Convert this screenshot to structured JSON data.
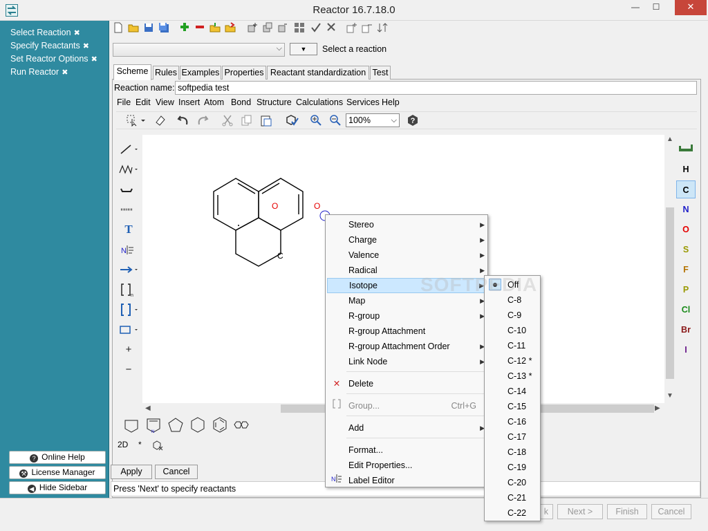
{
  "window": {
    "title": "Reactor 16.7.18.0",
    "min_glyph": "—",
    "max_glyph": "☐",
    "close_glyph": "✕"
  },
  "sidebar": {
    "steps": [
      {
        "label": "Select Reaction"
      },
      {
        "label": "Specify Reactants"
      },
      {
        "label": "Set Reactor Options"
      },
      {
        "label": "Run Reactor"
      }
    ],
    "step_marker": "✖",
    "online_help": "Online Help",
    "license_manager": "License Manager",
    "hide_sidebar": "Hide Sidebar"
  },
  "reaction_select": {
    "dropdown_glyph": "▼",
    "label": "Select a reaction"
  },
  "tabs": [
    {
      "label": "Scheme"
    },
    {
      "label": "Rules"
    },
    {
      "label": "Examples"
    },
    {
      "label": "Properties"
    },
    {
      "label": "Reactant standardization"
    },
    {
      "label": "Test"
    }
  ],
  "reaction_name": {
    "label": "Reaction name:",
    "value": "softpedia test"
  },
  "menubar": [
    {
      "label": "File"
    },
    {
      "label": "Edit"
    },
    {
      "label": "View"
    },
    {
      "label": "Insert"
    },
    {
      "label": "Atom"
    },
    {
      "label": "Bond"
    },
    {
      "label": "Structure"
    },
    {
      "label": "Calculations"
    },
    {
      "label": "Services"
    },
    {
      "label": "Help"
    }
  ],
  "zoom": {
    "value": "100%"
  },
  "molecule": {
    "atom_labels": [
      "O",
      "O",
      "C"
    ]
  },
  "elements": [
    "H",
    "C",
    "N",
    "O",
    "S",
    "F",
    "P",
    "Cl",
    "Br",
    "I"
  ],
  "element_colors": {
    "H": "#000000",
    "C": "#000000",
    "N": "#1e1ec8",
    "O": "#e60000",
    "S": "#999900",
    "F": "#b47300",
    "P": "#999900",
    "Cl": "#1a8a1a",
    "Br": "#8b1a1a",
    "I": "#6a1a8a"
  },
  "modes": {
    "dim": "2D",
    "star": "*"
  },
  "context_menu": {
    "items": [
      {
        "label": "Stereo",
        "has_sub": true
      },
      {
        "label": "Charge",
        "has_sub": true
      },
      {
        "label": "Valence",
        "has_sub": true
      },
      {
        "label": "Radical",
        "has_sub": true
      },
      {
        "label": "Isotope",
        "has_sub": true
      },
      {
        "label": "Map",
        "has_sub": true
      },
      {
        "label": "R-group",
        "has_sub": true
      },
      {
        "label": "R-group Attachment"
      },
      {
        "label": "R-group Attachment Order",
        "has_sub": true
      },
      {
        "label": "Link Node",
        "has_sub": true
      },
      {
        "label": "Delete"
      },
      {
        "label": "Group...",
        "shortcut": "Ctrl+G"
      },
      {
        "label": "Add",
        "has_sub": true
      },
      {
        "label": "Format..."
      },
      {
        "label": "Edit Properties..."
      },
      {
        "label": "Label Editor"
      }
    ],
    "sub_glyph": "▶",
    "delete_glyph": "✕"
  },
  "isotope_menu": [
    "Off",
    "C-8",
    "C-9",
    "C-10",
    "C-11",
    "C-12 *",
    "C-13 *",
    "C-14",
    "C-15",
    "C-16",
    "C-17",
    "C-18",
    "C-19",
    "C-20",
    "C-21",
    "C-22"
  ],
  "buttons": {
    "apply": "Apply",
    "cancel": "Cancel"
  },
  "status": "Press 'Next' to specify reactants",
  "wizard": {
    "back_fragment": "k",
    "next": "Next >",
    "finish": "Finish",
    "cancel": "Cancel"
  },
  "watermark": "SOFTPEDIA"
}
